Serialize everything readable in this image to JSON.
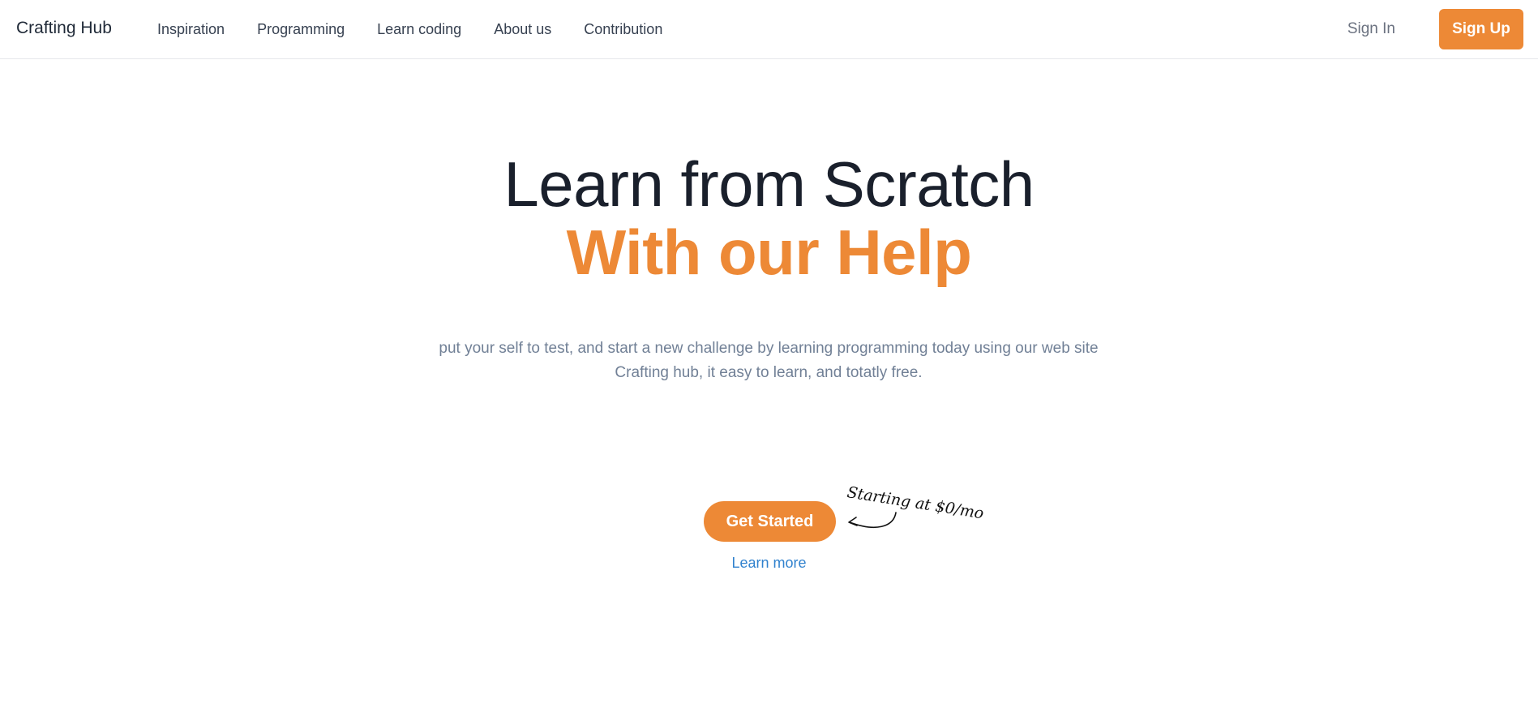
{
  "navbar": {
    "brand": "Crafting Hub",
    "links": [
      "Inspiration",
      "Programming",
      "Learn coding",
      "About us",
      "Contribution"
    ],
    "sign_in": "Sign In",
    "sign_up": "Sign Up"
  },
  "hero": {
    "headline_main": "Learn from Scratch",
    "headline_accent": "With our Help",
    "subtext_line1": "put your self to test, and start a new challenge by learning programming today using our web site",
    "subtext_line2": "Crafting hub, it easy to learn, and totatly free.",
    "cta_label": "Get Started",
    "learn_more": "Learn more",
    "pricing_note": "Starting at $0/mo"
  },
  "icons": {
    "annotation_arrow": "curved-arrow-icon"
  },
  "colors": {
    "accent": "#ed8936",
    "heading": "#1a202c",
    "muted": "#718096",
    "link": "#3182ce"
  }
}
